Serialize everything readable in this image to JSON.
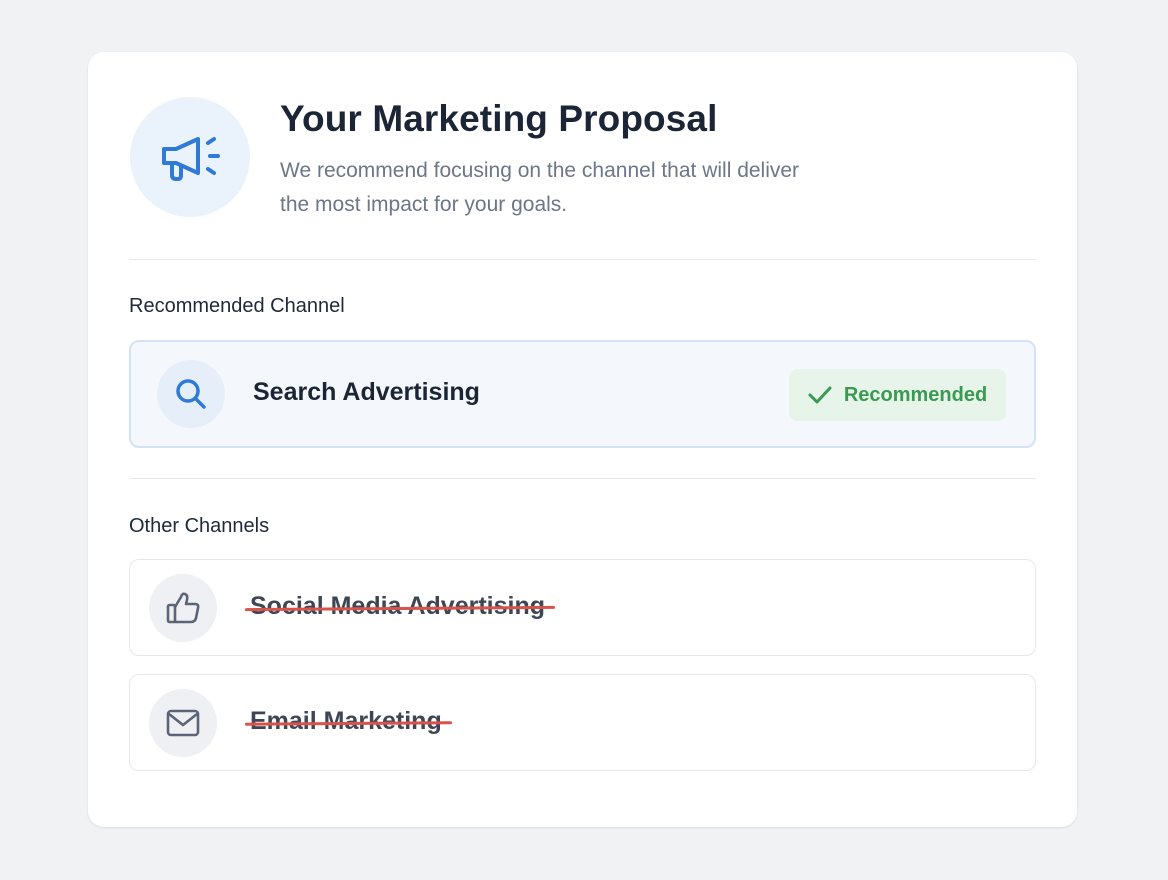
{
  "header": {
    "title": "Your Marketing Proposal",
    "subtitle": "We recommend focusing on the channel that will deliver the most impact for your goals.",
    "icon": "megaphone-icon"
  },
  "recommended_section": {
    "label": "Recommended Channel",
    "channel": {
      "name": "Search Advertising",
      "icon": "search-icon",
      "badge": "Recommended",
      "badge_icon": "check-icon"
    }
  },
  "other_section": {
    "label": "Other Channels",
    "channels": [
      {
        "name": "Social Media Advertising",
        "icon": "thumbs-up-icon",
        "struck_through": true
      },
      {
        "name": "Email Marketing",
        "icon": "mail-icon",
        "struck_through": true
      }
    ]
  },
  "colors": {
    "accent": "#2f7ad6",
    "success": "#3b9a52",
    "strike": "#d9534a",
    "title": "#1b2535"
  }
}
